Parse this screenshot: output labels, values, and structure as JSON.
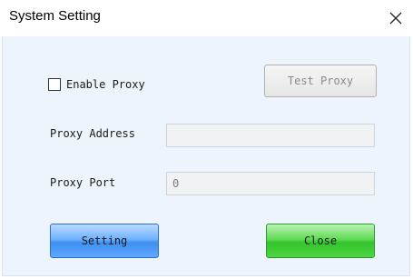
{
  "window": {
    "title": "System Setting"
  },
  "proxy": {
    "enable_label": "Enable Proxy",
    "enable_checked": false,
    "test_button_label": "Test Proxy",
    "address_label": "Proxy Address",
    "address_value": "",
    "port_label": "Proxy Port",
    "port_value": "0"
  },
  "buttons": {
    "setting_label": "Setting",
    "close_label": "Close"
  }
}
